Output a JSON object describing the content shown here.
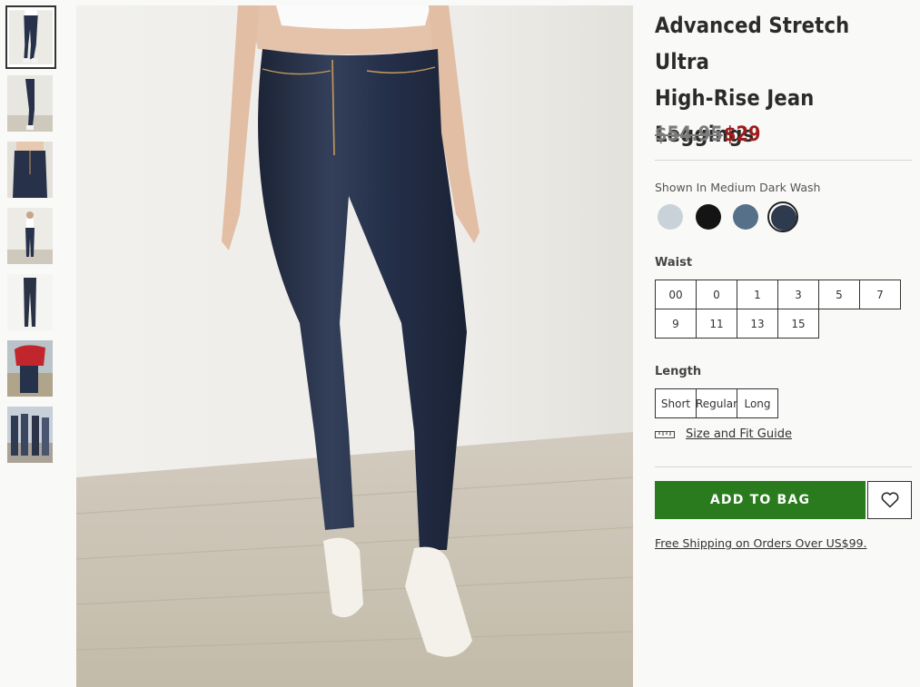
{
  "product": {
    "title_lines": [
      "Advanced Stretch Ultra",
      "High-Rise Jean",
      "Leggings"
    ],
    "price_original": "$54.95",
    "price_sale": "$29"
  },
  "color": {
    "label": "Shown In Medium Dark Wash",
    "swatches": [
      {
        "name": "light-wash-swatch",
        "color": "#c9d2d8",
        "selected": false
      },
      {
        "name": "black-swatch",
        "color": "#141414",
        "selected": false
      },
      {
        "name": "medium-wash-swatch",
        "color": "#56708a",
        "selected": false
      },
      {
        "name": "medium-dark-wash-swatch",
        "color": "#2e3a4e",
        "selected": true
      }
    ]
  },
  "waist": {
    "label": "Waist",
    "sizes": [
      "00",
      "0",
      "1",
      "3",
      "5",
      "7",
      "9",
      "11",
      "13",
      "15"
    ]
  },
  "length": {
    "label": "Length",
    "options": [
      "Short",
      "Regular",
      "Long"
    ]
  },
  "size_guide": {
    "label": "Size and Fit Guide",
    "icon": "ruler-icon"
  },
  "actions": {
    "add_to_bag": "ADD TO BAG",
    "wishlist_icon": "heart-icon"
  },
  "shipping": {
    "text": "Free Shipping on Orders Over US$99."
  },
  "colors": {
    "accent_green": "#2a7a1e",
    "sale_red": "#a01c1c",
    "denim": "#27324a"
  },
  "thumbnails": [
    "front-view",
    "side-view",
    "waist-closeup",
    "full-body",
    "flat-lay",
    "lifestyle-red-sweater",
    "group-lifestyle"
  ]
}
